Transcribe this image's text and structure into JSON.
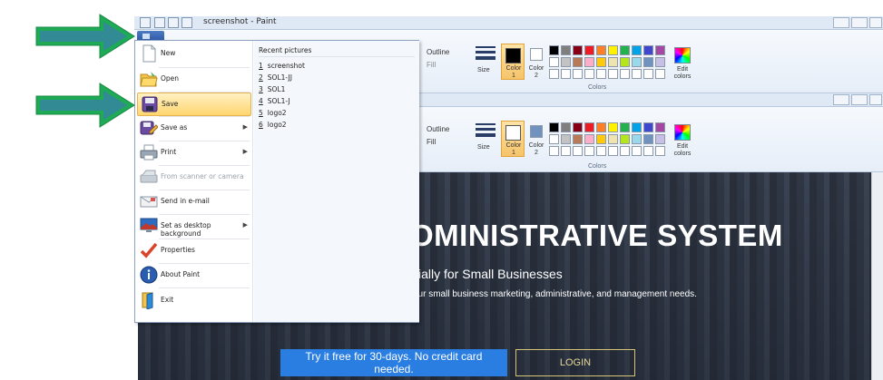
{
  "window": {
    "title": "screenshot - Paint"
  },
  "ribbon": {
    "outline_label": "Outline",
    "fill_label": "Fill",
    "size_label": "Size",
    "color1_label": "Color",
    "color1_num": "1",
    "color2_label": "Color",
    "color2_num": "2",
    "edit_colors_line1": "Edit",
    "edit_colors_line2": "colors",
    "colors_group_label": "Colors"
  },
  "palette": {
    "row1": [
      "#000000",
      "#7f7f7f",
      "#880015",
      "#ed1c24",
      "#ff7f27",
      "#fff200",
      "#22b14c",
      "#00a2e8",
      "#3f48cc",
      "#a349a4"
    ],
    "row2": [
      "#ffffff",
      "#c3c3c3",
      "#b97a57",
      "#ffaec9",
      "#ffc90e",
      "#efe4b0",
      "#b5e61d",
      "#99d9ea",
      "#7092be",
      "#c8bfe7"
    ],
    "row3": [
      "#ffffff",
      "#ffffff",
      "#ffffff",
      "#ffffff",
      "#ffffff",
      "#ffffff",
      "#ffffff",
      "#ffffff",
      "#ffffff",
      "#ffffff"
    ]
  },
  "file_menu": {
    "items": [
      {
        "label": "New",
        "icon": "new-file-icon"
      },
      {
        "label": "Open",
        "icon": "open-folder-icon"
      },
      {
        "label": "Save",
        "icon": "save-disk-icon"
      },
      {
        "label": "Save as",
        "icon": "save-as-icon"
      },
      {
        "label": "Print",
        "icon": "printer-icon"
      },
      {
        "label": "From scanner or camera",
        "icon": "scanner-icon"
      },
      {
        "label": "Send in e-mail",
        "icon": "email-icon"
      },
      {
        "label": "Set as desktop background",
        "icon": "desktop-background-icon"
      },
      {
        "label": "Properties",
        "icon": "checkmark-icon"
      },
      {
        "label": "About Paint",
        "icon": "info-icon"
      },
      {
        "label": "Exit",
        "icon": "exit-icon"
      }
    ],
    "recent_title": "Recent pictures",
    "recent": [
      {
        "num": "1",
        "name": "screenshot"
      },
      {
        "num": "2",
        "name": "SOL1-JJ"
      },
      {
        "num": "3",
        "name": "SOL1"
      },
      {
        "num": "4",
        "name": "SOL1-J"
      },
      {
        "num": "5",
        "name": "logo2"
      },
      {
        "num": "6",
        "name": "logo2"
      }
    ]
  },
  "hero": {
    "title": "OMINISTRATIVE SYSTEM",
    "subtitle": "cially for Small Businesses",
    "text": "our small business marketing, administrative, and management needs.",
    "trial_button": "Try it free for 30-days. No credit card needed.",
    "login_button": "LOGIN"
  },
  "colors": {
    "accent_blue": "#2a7de1",
    "menu_highlight": "#ffd56e",
    "arrow_green": "#1fb25a"
  }
}
